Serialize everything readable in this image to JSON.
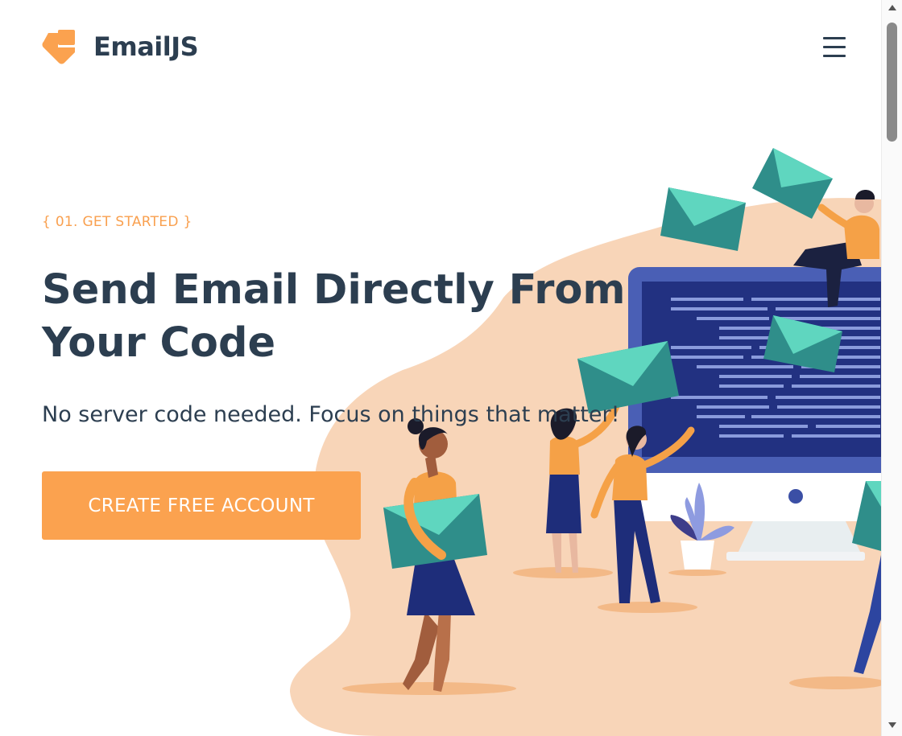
{
  "header": {
    "brand": "EmailJS",
    "logo_icon": "emailjs-logo-icon",
    "menu_icon": "hamburger-menu-icon"
  },
  "hero": {
    "eyebrow": "{ 01. GET STARTED }",
    "headline": "Send Email Directly From Your Code",
    "subheadline": "No server code needed. Focus on things that matter!",
    "cta_label": "CREATE FREE ACCOUNT"
  },
  "colors": {
    "accent": "#fba24f",
    "text": "#2c3e50",
    "blob": "#f8d5b8",
    "envelope": "#5fd6bf",
    "monitor": "#2d3a8c"
  }
}
